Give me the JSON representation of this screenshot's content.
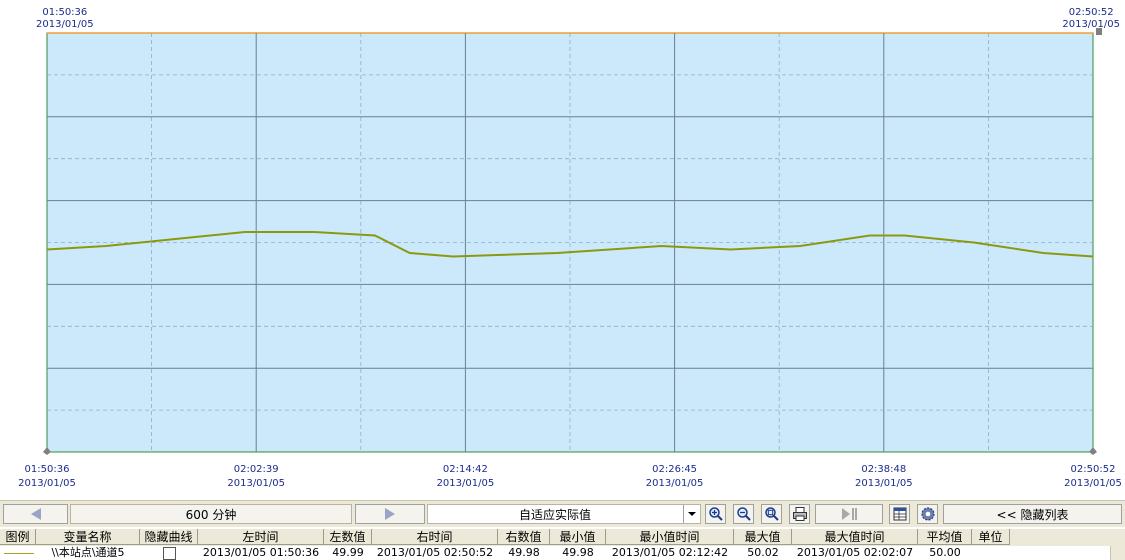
{
  "corners": {
    "top_left": {
      "time": "01:50:36",
      "date": "2013/01/05"
    },
    "top_right": {
      "time": "02:50:52",
      "date": "2013/01/05"
    }
  },
  "chart_data": {
    "type": "line",
    "grid": true,
    "x_ticks": [
      {
        "time": "01:50:36",
        "date": "2013/01/05"
      },
      {
        "time": "02:02:39",
        "date": "2013/01/05"
      },
      {
        "time": "02:14:42",
        "date": "2013/01/05"
      },
      {
        "time": "02:26:45",
        "date": "2013/01/05"
      },
      {
        "time": "02:38:48",
        "date": "2013/01/05"
      },
      {
        "time": "02:50:52",
        "date": "2013/01/05"
      }
    ],
    "xlim": [
      "2013/01/05 01:50:36",
      "2013/01/05 02:50:52"
    ],
    "series": [
      {
        "name": "\\\\本站点\\通道5",
        "color": "#8a9a10",
        "x": [
          "01:50:36",
          "01:54:00",
          "01:58:00",
          "02:02:00",
          "02:06:00",
          "02:09:30",
          "02:11:30",
          "02:14:00",
          "02:20:00",
          "02:26:00",
          "02:30:00",
          "02:34:00",
          "02:38:00",
          "02:40:00",
          "02:44:00",
          "02:48:00",
          "02:50:52"
        ],
        "y": [
          49.99,
          49.995,
          50.005,
          50.015,
          50.015,
          50.01,
          49.985,
          49.98,
          49.985,
          49.995,
          49.99,
          49.995,
          50.01,
          50.01,
          50.0,
          49.985,
          49.98
        ]
      }
    ],
    "ylim": [
      49.7,
      50.3
    ]
  },
  "toolbar": {
    "span_label": "600 分钟",
    "mode_label": "自适应实际值",
    "hide_list_label": "<< 隐藏列表",
    "icons": [
      "arrow-left-icon",
      "arrow-right-icon",
      "zoom-in-icon",
      "zoom-out-icon",
      "zoom-fit-icon",
      "print-icon",
      "play-pause-icon",
      "table-icon",
      "settings-icon"
    ]
  },
  "table": {
    "headers": [
      "图例",
      "变量名称",
      "隐藏曲线",
      "左时间",
      "左数值",
      "右时间",
      "右数值",
      "最小值",
      "最小值时间",
      "最大值",
      "最大值时间",
      "平均值",
      "单位"
    ],
    "rows": [
      {
        "legend_color": "#b0a020",
        "variable": "\\\\本站点\\通道5",
        "hidden": false,
        "left_time": "2013/01/05 01:50:36",
        "left_value": "49.99",
        "right_time": "2013/01/05 02:50:52",
        "right_value": "49.98",
        "min_value": "49.98",
        "min_time": "2013/01/05 02:12:42",
        "max_value": "50.02",
        "max_time": "2013/01/05 02:02:07",
        "avg_value": "50.00",
        "unit": ""
      }
    ]
  }
}
